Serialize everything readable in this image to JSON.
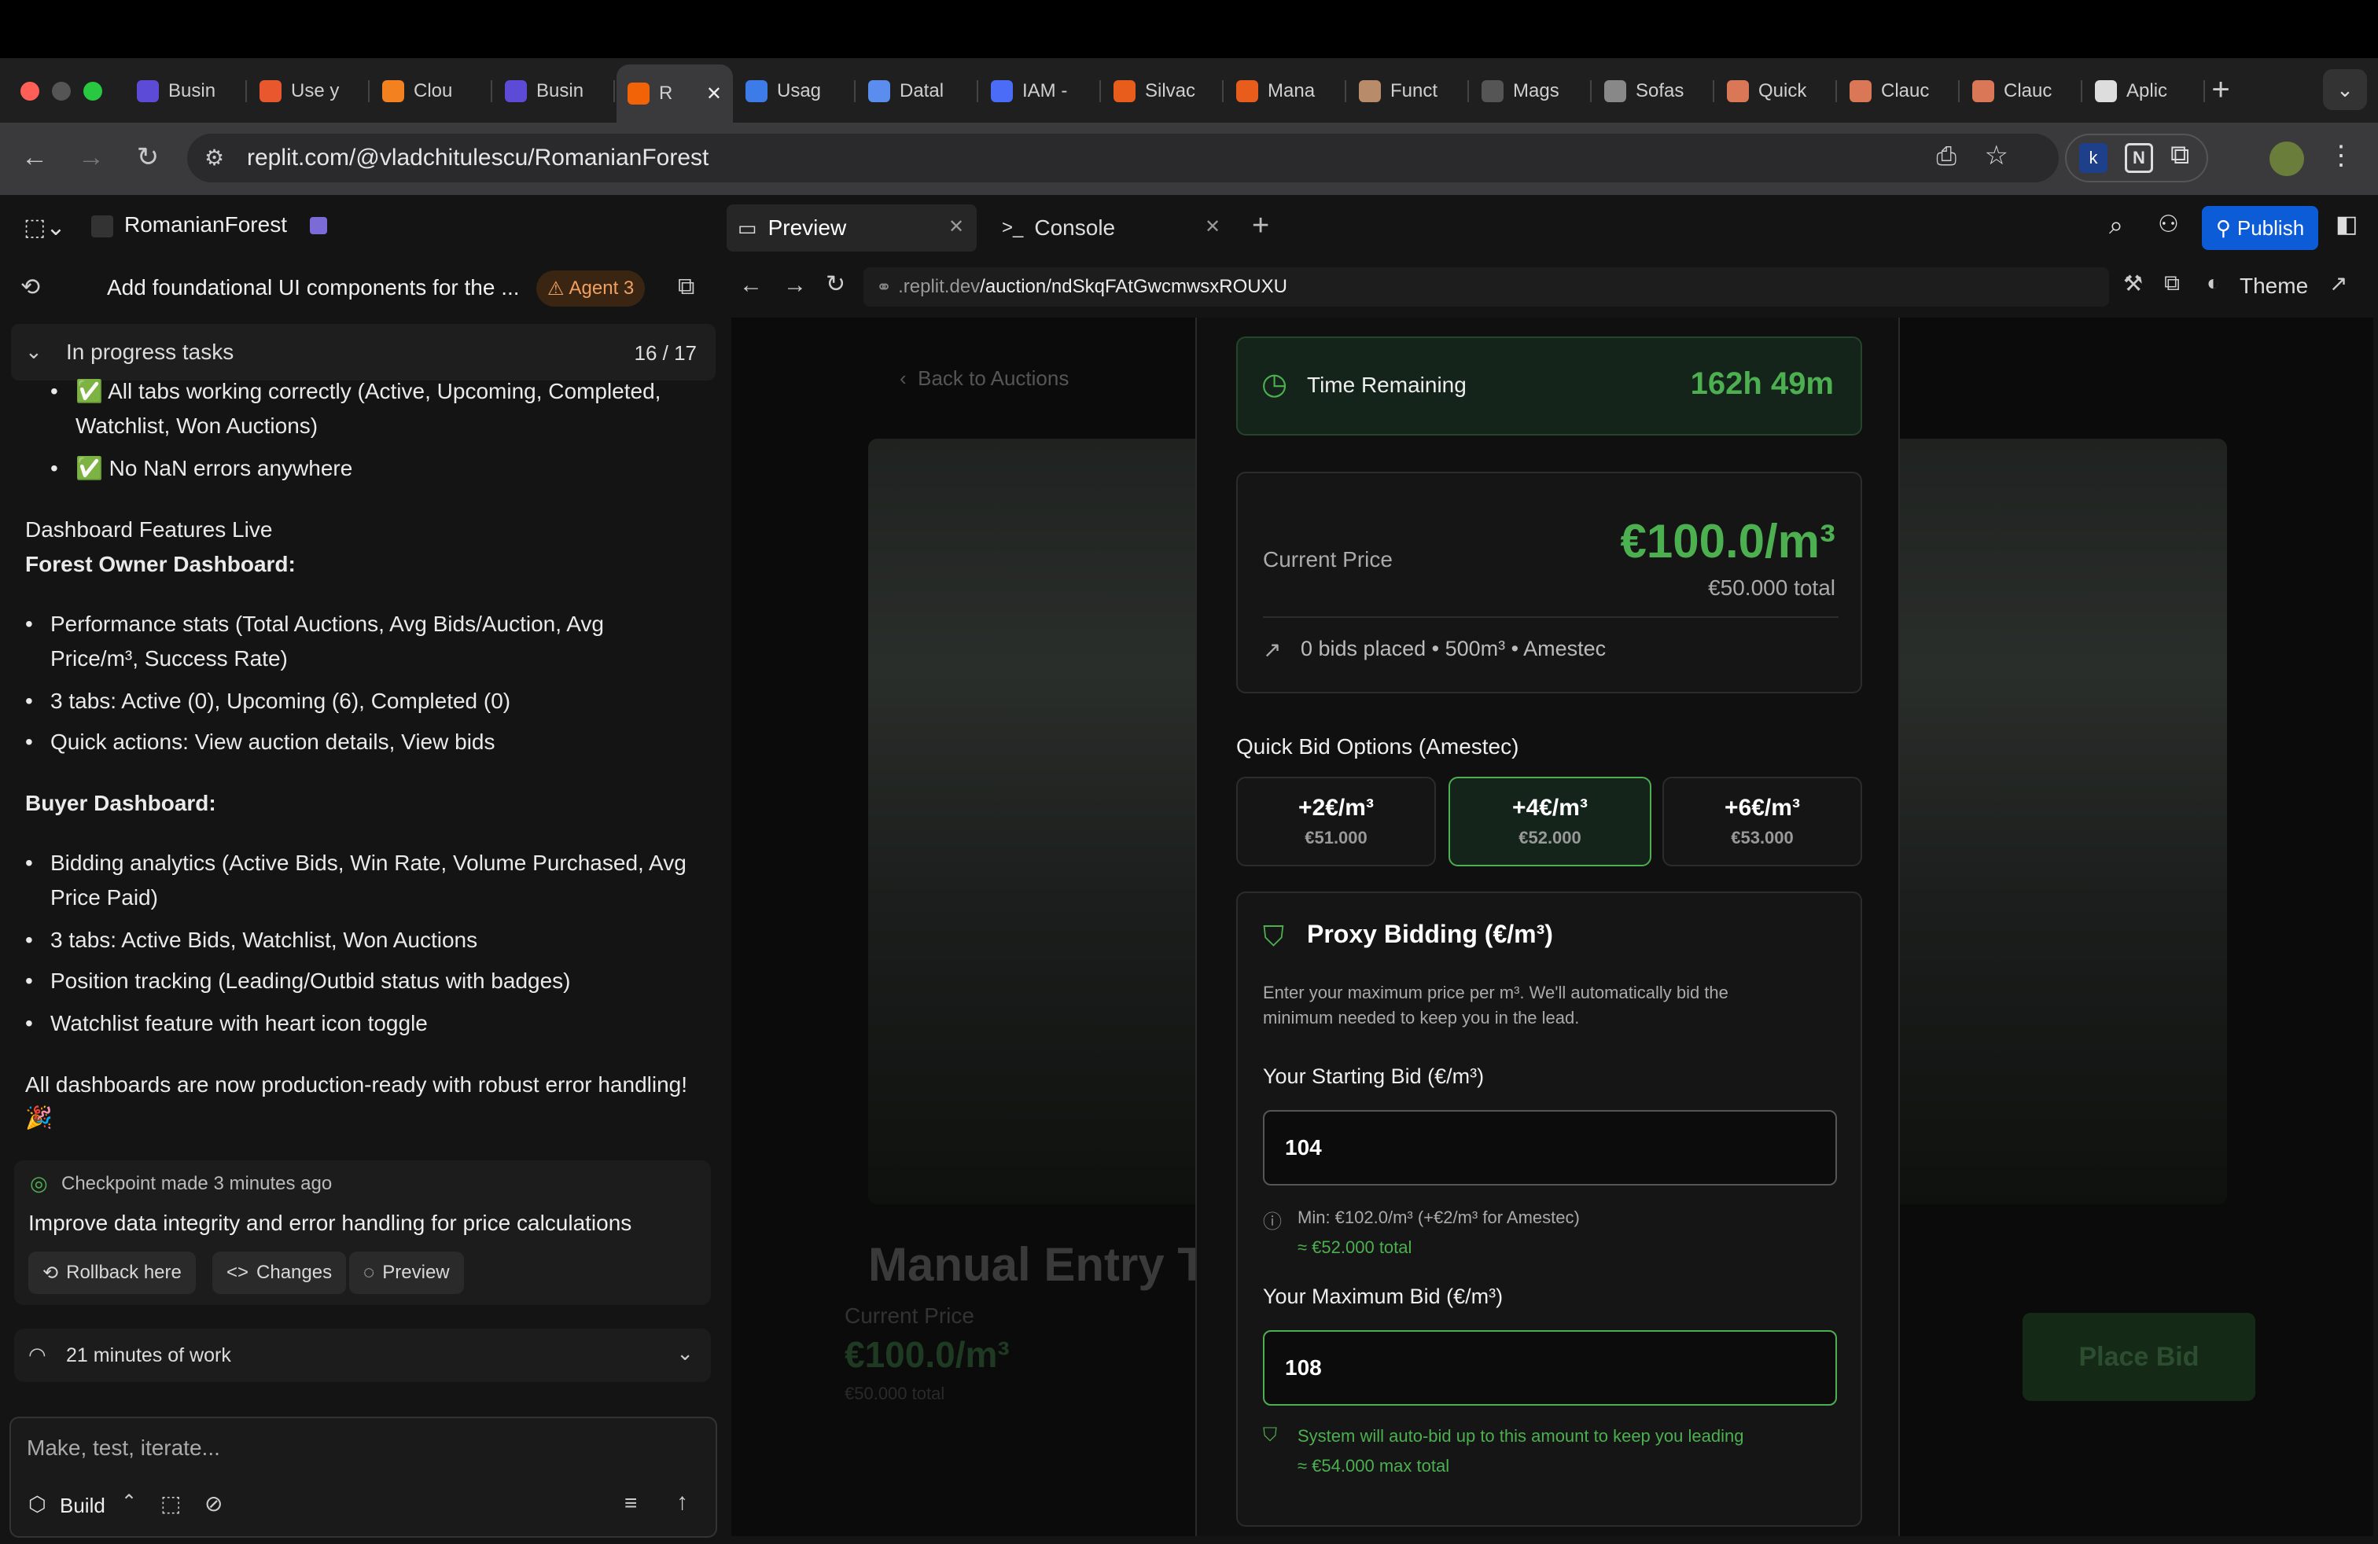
{
  "browser": {
    "tabs": [
      {
        "label": "Busin",
        "color": "#5b4bd6"
      },
      {
        "label": "Use y",
        "color": "#e8572e"
      },
      {
        "label": "Clou",
        "color": "#f48120"
      },
      {
        "label": "Busin",
        "color": "#5b4bd6"
      },
      {
        "label": "R",
        "color": "#f26207",
        "active": true
      },
      {
        "label": "Usag",
        "color": "#3d7be8"
      },
      {
        "label": "Datal",
        "color": "#5a8dee"
      },
      {
        "label": "IAM -",
        "color": "#4a6cf7"
      },
      {
        "label": "Silvac",
        "color": "#e85d1c"
      },
      {
        "label": "Mana",
        "color": "#e85d1c"
      },
      {
        "label": "Funct",
        "color": "#b88c6a"
      },
      {
        "label": "Mags",
        "color": "#555555"
      },
      {
        "label": "Sofas",
        "color": "#888888"
      },
      {
        "label": "Quick",
        "color": "#d97757"
      },
      {
        "label": "Clauc",
        "color": "#d97757"
      },
      {
        "label": "Clauc",
        "color": "#d97757"
      },
      {
        "label": "Aplic",
        "color": "#dddddd"
      }
    ],
    "url": "replit.com/@vladchitulescu/RomanianForest"
  },
  "replit": {
    "project_name": "RomanianForest",
    "preview_tab": "Preview",
    "console_tab": "Console",
    "publish_label": "Publish",
    "theme_label": "Theme",
    "preview_url_prefix": ".replit.dev",
    "preview_url_path": "/auction/ndSkqFAtGwcmwsxROUXU"
  },
  "agent": {
    "thread_title": "Add foundational UI components for the ...",
    "agent_badge": "Agent 3",
    "tasks_header": "In progress tasks",
    "tasks_count": "16 / 17",
    "top_bullets": [
      "✅ All tabs working correctly (Active, Upcoming, Completed,",
      "Watchlist, Won Auctions)",
      "✅ No NaN errors anywhere"
    ],
    "features_heading": "Dashboard Features Live",
    "owner_heading": "Forest Owner Dashboard:",
    "owner_bullets": [
      "Performance stats (Total Auctions, Avg Bids/Auction, Avg",
      "Price/m³, Success Rate)",
      "3 tabs: Active (0), Upcoming (6), Completed (0)",
      "Quick actions: View auction details, View bids"
    ],
    "buyer_heading": "Buyer Dashboard:",
    "buyer_bullets": [
      "Bidding analytics (Active Bids, Win Rate, Volume Purchased, Avg",
      "Price Paid)",
      "3 tabs: Active Bids, Watchlist, Won Auctions",
      "Position tracking (Leading/Outbid status with badges)",
      "Watchlist feature with heart icon toggle"
    ],
    "closing_line1": "All dashboards are now production-ready with robust error handling!",
    "closing_line2": "🎉",
    "checkpoint_label": "Checkpoint made 3 minutes ago",
    "checkpoint_desc": "Improve data integrity and error handling for price calculations",
    "rollback_label": "Rollback here",
    "changes_label": "Changes",
    "preview_label": "Preview",
    "work_label": "21 minutes of work",
    "input_placeholder": "Make, test, iterate...",
    "build_label": "Build"
  },
  "auction": {
    "back_label": "Back to Auctions",
    "bg_title": "Manual Entry T",
    "bg_current_price_label": "Current Price",
    "bg_price": "€100.0/m³",
    "bg_total": "€50.000 total",
    "bg_place_bid": "Place Bid",
    "time_label": "Time Remaining",
    "time_value": "162h 49m",
    "current_price_label": "Current Price",
    "current_price": "€100.0/m³",
    "current_total": "€50.000 total",
    "bids_info": "0 bids placed • 500m³ • Amestec",
    "quick_bid_title": "Quick Bid Options (Amestec)",
    "quick_bids": [
      {
        "increment": "+2€/m³",
        "total": "€51.000"
      },
      {
        "increment": "+4€/m³",
        "total": "€52.000",
        "selected": true
      },
      {
        "increment": "+6€/m³",
        "total": "€53.000"
      }
    ],
    "proxy_title": "Proxy Bidding (€/m³)",
    "proxy_desc_line1": "Enter your maximum price per m³. We'll automatically bid the",
    "proxy_desc_line2": "minimum needed to keep you in the lead.",
    "starting_bid_label": "Your Starting Bid (€/m³)",
    "starting_bid_value": "104",
    "min_note": "Min: €102.0/m³ (+€2/m³ for Amestec)",
    "min_total": "≈ €52.000 total",
    "max_bid_label": "Your Maximum Bid (€/m³)",
    "max_bid_value": "108",
    "auto_note": "System will auto-bid up to this amount to keep you leading",
    "max_total": "≈ €54.000 max total"
  },
  "colors": {
    "accent_green": "#4caf50",
    "publish_blue": "#0b5cd6"
  }
}
